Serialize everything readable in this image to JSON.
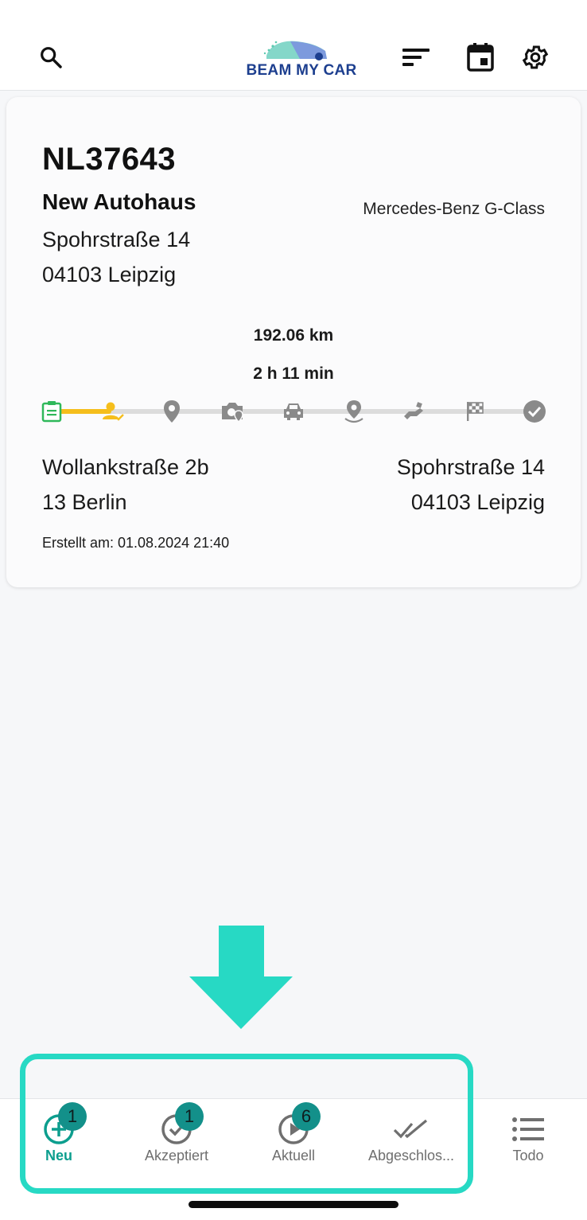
{
  "header": {
    "logo_text": "BEAM MY CAR",
    "icons": [
      "search-icon",
      "sort-icon",
      "calendar-icon",
      "gear-icon"
    ]
  },
  "order": {
    "plate": "NL37643",
    "dealer_name": "New Autohaus",
    "vehicle_model": "Mercedes-Benz G-Class",
    "dealer_street": "Spohrstraße 14",
    "dealer_city": "04103 Leipzig",
    "distance": "192.06 km",
    "duration": "2 h 11 min",
    "progress": {
      "completed_steps": 2,
      "total_steps": 9,
      "steps": [
        "clipboard-icon",
        "person-check-icon",
        "location-pin-icon",
        "camera-location-icon",
        "car-icon",
        "location-person-icon",
        "handover-icon",
        "finish-flag-icon",
        "checkmark-circle-icon"
      ],
      "colors": {
        "done": "#2fb85a",
        "active": "#f5be1c",
        "pending": "#8a8a8a"
      }
    },
    "from_street": "Wollankstraße 2b",
    "from_city": "13 Berlin",
    "to_street": "Spohrstraße 14",
    "to_city": "04103 Leipzig",
    "created": "Erstellt am: 01.08.2024 21:40"
  },
  "tabbar": {
    "tabs": [
      {
        "label": "Neu",
        "badge": "1",
        "icon": "plus-circle-icon",
        "active": true
      },
      {
        "label": "Akzeptiert",
        "badge": "1",
        "icon": "check-circle-icon",
        "active": false
      },
      {
        "label": "Aktuell",
        "badge": "6",
        "icon": "play-circle-icon",
        "active": false
      },
      {
        "label": "Abgeschlos...",
        "badge": "",
        "icon": "double-check-icon",
        "active": false
      },
      {
        "label": "Todo",
        "badge": "",
        "icon": "list-icon",
        "active": false
      }
    ]
  },
  "colors": {
    "accent": "#0c9e8e",
    "badge": "#13908a",
    "highlight": "#27d9c4"
  }
}
